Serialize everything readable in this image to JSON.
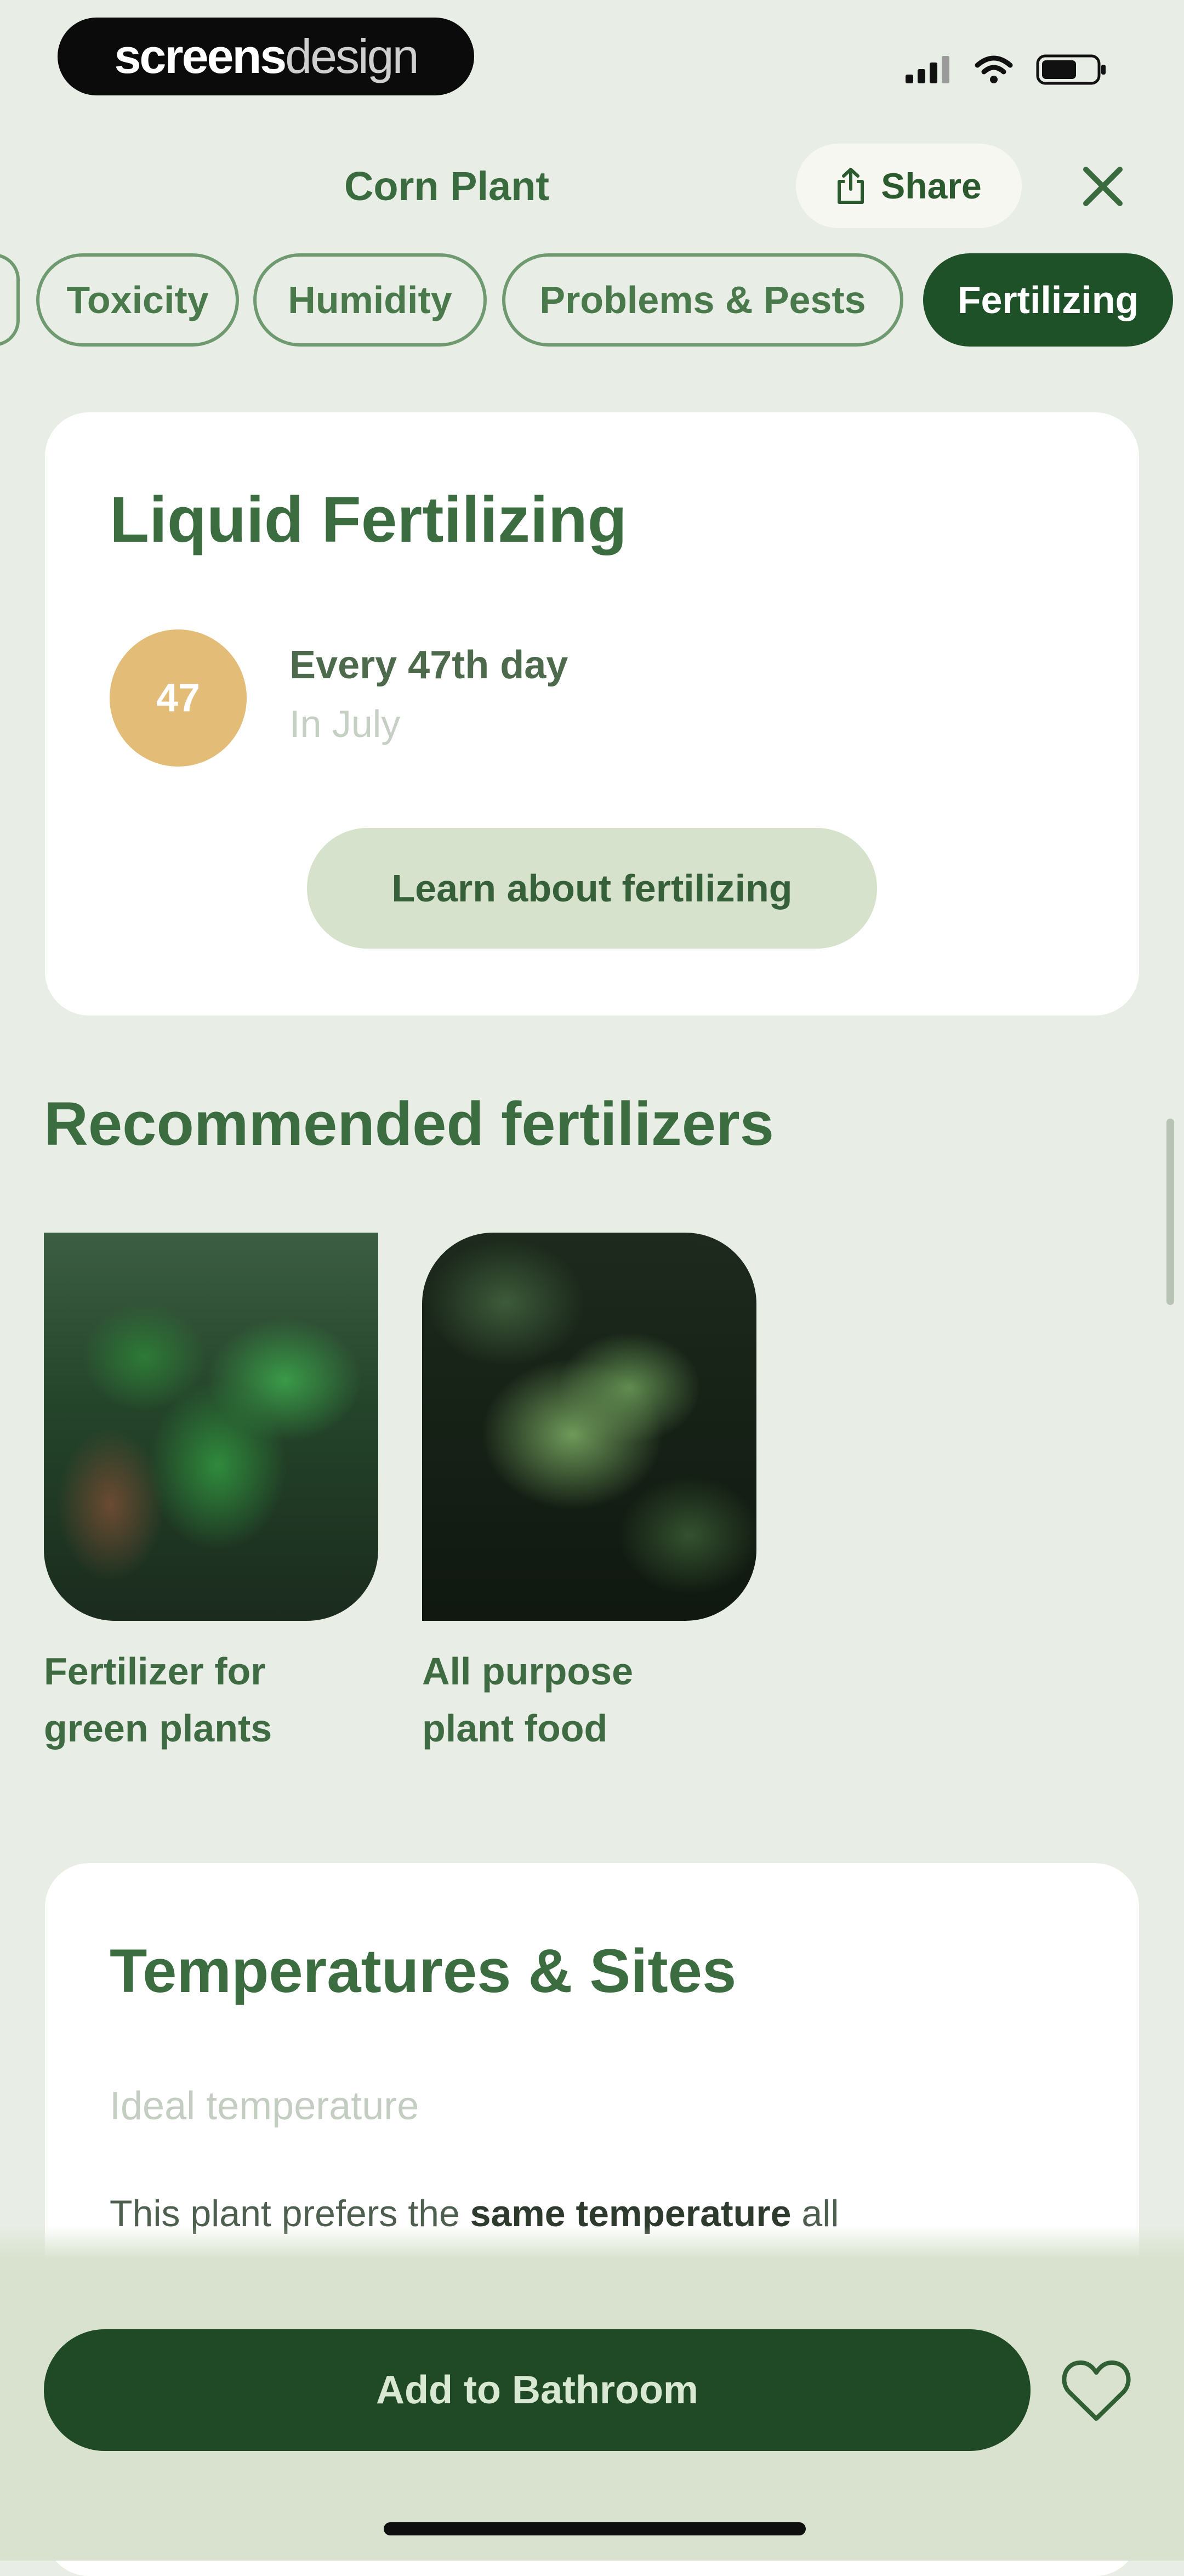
{
  "status_bar": {
    "brand_part1": "screens",
    "brand_part2": "design"
  },
  "header": {
    "title": "Corn Plant",
    "share_label": "Share"
  },
  "tabs": [
    {
      "label": "Toxicity",
      "active": false
    },
    {
      "label": "Humidity",
      "active": false
    },
    {
      "label": "Problems & Pests",
      "active": false
    },
    {
      "label": "Fertilizing",
      "active": true
    }
  ],
  "fertilizing": {
    "heading": "Liquid Fertilizing",
    "badge_value": "47",
    "frequency": "Every 47th day",
    "month": "In July",
    "learn_button": "Learn about fertilizing"
  },
  "recommended": {
    "heading": "Recommended fertilizers",
    "items": [
      {
        "label_line1": "Fertilizer for",
        "label_line2": "green plants"
      },
      {
        "label_line1": "All purpose",
        "label_line2": "plant food"
      }
    ]
  },
  "temperatures": {
    "heading": "Temperatures & Sites",
    "subheading": "Ideal temperature",
    "text_prefix": "This plant prefers the ",
    "text_bold": "same temperature",
    "text_suffix": " all"
  },
  "bottom": {
    "add_button": "Add to Bathroom"
  },
  "colors": {
    "background": "#e8ede5",
    "primary_dark_green": "#1f5128",
    "accent_green": "#3b6d40",
    "badge_gold": "#e3bd78",
    "learn_button_bg": "#d6e2cc"
  }
}
